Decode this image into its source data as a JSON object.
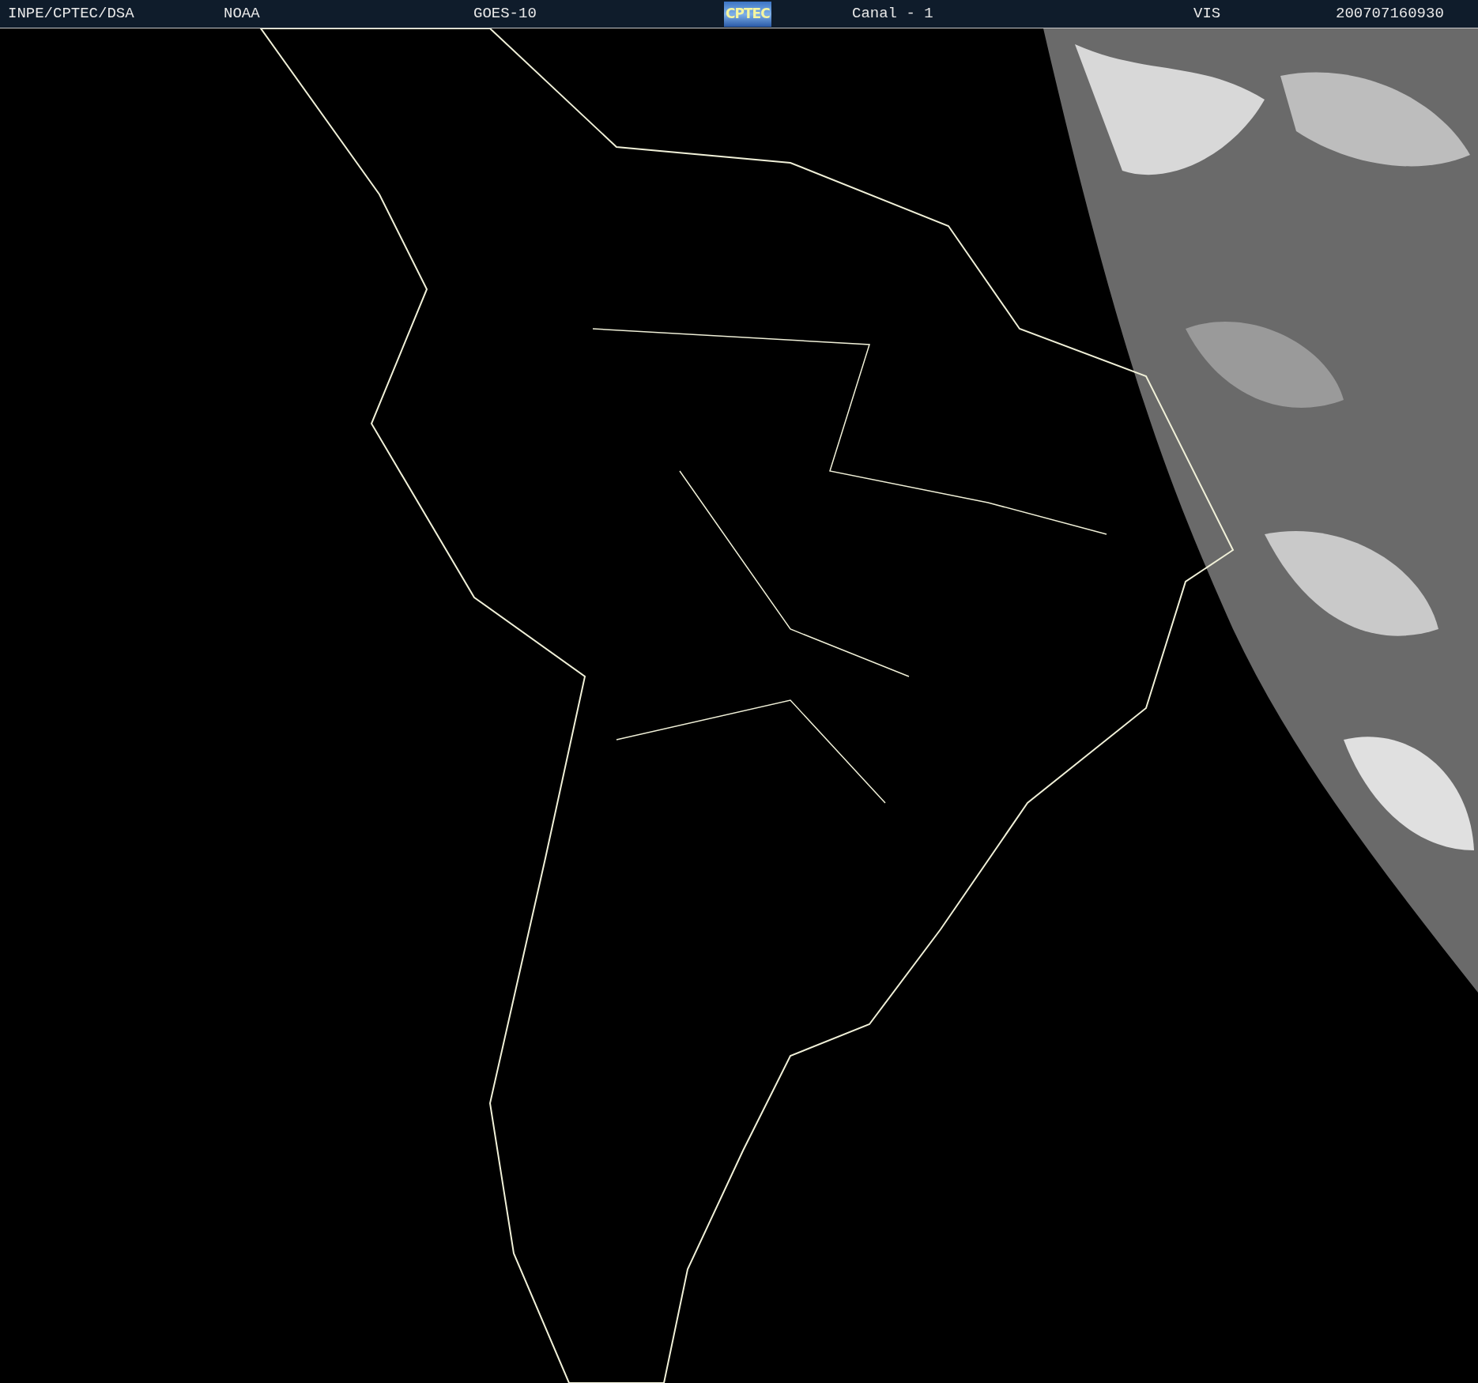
{
  "header": {
    "items": [
      {
        "kind": "text",
        "text": "INPE/CPTEC/DSA"
      },
      {
        "kind": "text",
        "text": "NOAA"
      },
      {
        "kind": "text",
        "text": "GOES-10"
      },
      {
        "kind": "logo",
        "text": "CPTEC"
      },
      {
        "kind": "text",
        "text": "Canal - 1"
      },
      {
        "kind": "text",
        "text": "VIS"
      },
      {
        "kind": "text",
        "text": "200707160930"
      }
    ]
  }
}
